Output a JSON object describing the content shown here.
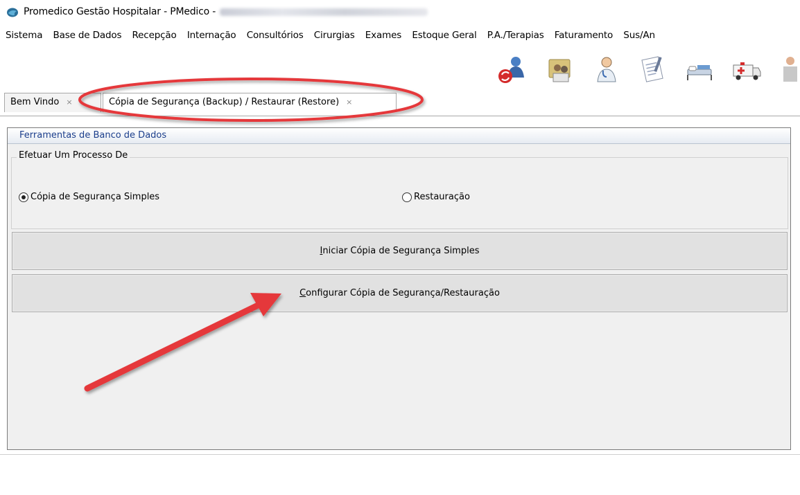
{
  "window": {
    "title": "Promedico Gestão Hospitalar - PMedico -"
  },
  "menu": {
    "items": [
      "Sistema",
      "Base de Dados",
      "Recepção",
      "Internação",
      "Consultórios",
      "Cirurgias",
      "Exames",
      "Estoque Geral",
      "P.A./Terapias",
      "Faturamento",
      "Sus/An"
    ]
  },
  "toolbar": {
    "icons": [
      "users-refresh-icon",
      "patients-folder-icon",
      "doctor-icon",
      "document-icon",
      "hospital-bed-icon",
      "ambulance-icon"
    ]
  },
  "tabs": [
    {
      "label": "Bem Vindo",
      "close": "×"
    },
    {
      "label": "Cópia de Segurança (Backup) / Restaurar (Restore)",
      "close": "×"
    }
  ],
  "panel": {
    "header": "Ferramentas de Banco de Dados",
    "group_title": "Efetuar Um Processo De",
    "options": [
      {
        "label": "Cópia de Segurança Simples",
        "selected": true
      },
      {
        "label": "Restauração",
        "selected": false
      }
    ],
    "buttons": {
      "start_backup": "Iniciar Cópia de Segurança Simples",
      "configure": "Configurar Cópia de Segurança/Restauração"
    }
  },
  "annotation": {
    "color": "#e5383b"
  }
}
